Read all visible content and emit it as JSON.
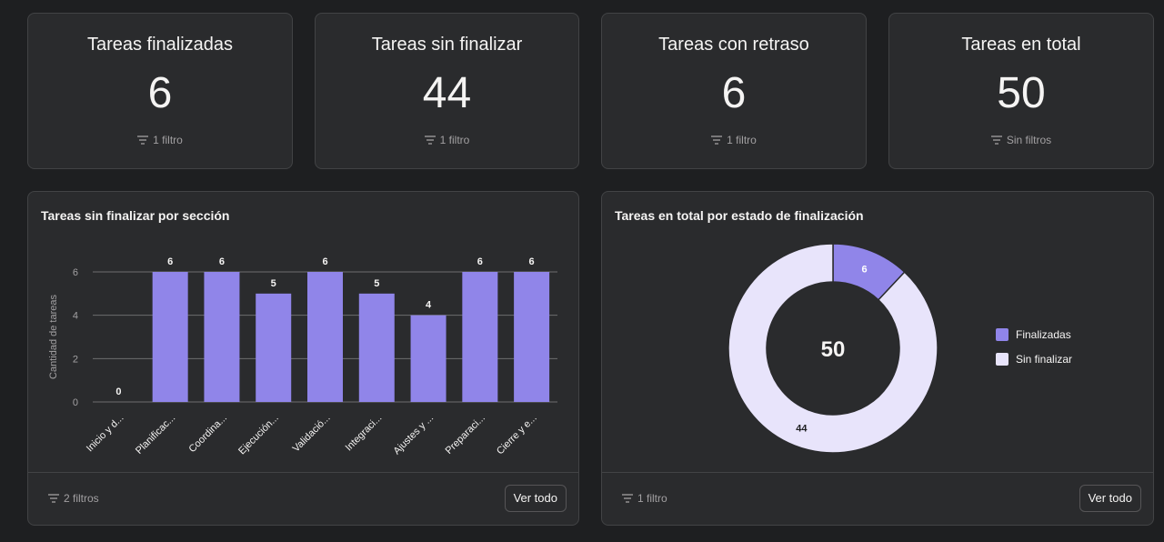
{
  "stats": [
    {
      "title": "Tareas finalizadas",
      "value": "6",
      "filter": "1 filtro"
    },
    {
      "title": "Tareas sin finalizar",
      "value": "44",
      "filter": "1 filtro"
    },
    {
      "title": "Tareas con retraso",
      "value": "6",
      "filter": "1 filtro"
    },
    {
      "title": "Tareas en total",
      "value": "50",
      "filter": "Sin filtros"
    }
  ],
  "bar_card": {
    "title": "Tareas sin finalizar por sección",
    "filter": "2 filtros",
    "button": "Ver todo"
  },
  "donut_card": {
    "title": "Tareas en total por estado de finalización",
    "filter": "1 filtro",
    "button": "Ver todo",
    "center_label": "50"
  },
  "chart_data": [
    {
      "type": "bar",
      "title": "Tareas sin finalizar por sección",
      "ylabel": "Cantidad de tareas",
      "xlabel": "",
      "categories": [
        "Inicio y d...",
        "Planificac...",
        "Coordina...",
        "Ejecución...",
        "Validació...",
        "Integraci...",
        "Ajustes y ...",
        "Preparaci...",
        "Cierre y e..."
      ],
      "values": [
        0,
        6,
        6,
        5,
        6,
        5,
        4,
        6,
        6
      ],
      "ylim": [
        0,
        6
      ],
      "yticks": [
        0,
        2,
        4,
        6
      ],
      "grid": true,
      "color": "#9085e9"
    },
    {
      "type": "pie",
      "title": "Tareas en total por estado de finalización",
      "categories": [
        "Finalizadas",
        "Sin finalizar"
      ],
      "values": [
        6,
        44
      ],
      "colors": [
        "#9085e9",
        "#e8e4fb"
      ],
      "legend": "right",
      "center_total": 50
    }
  ],
  "colors": {
    "background": "#1e1f21",
    "card": "#2a2b2d",
    "border": "#424345",
    "bar": "#9085e9",
    "donut_light": "#e8e4fb"
  }
}
